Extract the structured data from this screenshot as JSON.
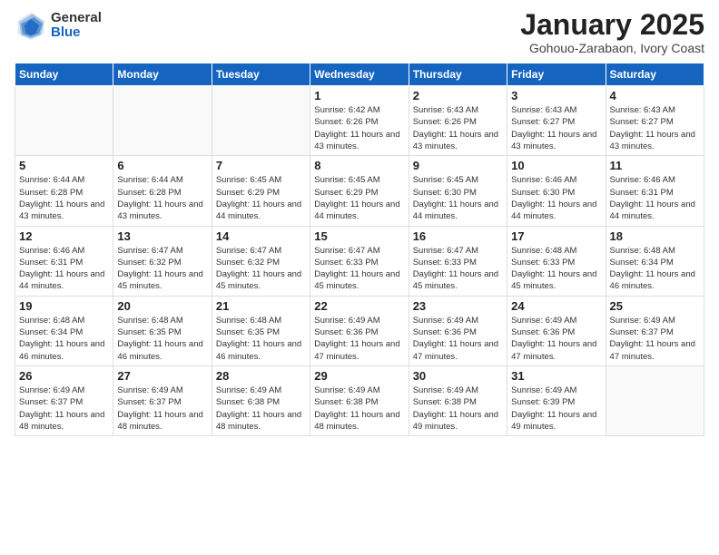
{
  "header": {
    "logo_general": "General",
    "logo_blue": "Blue",
    "month_title": "January 2025",
    "subtitle": "Gohouo-Zarabaon, Ivory Coast"
  },
  "days_of_week": [
    "Sunday",
    "Monday",
    "Tuesday",
    "Wednesday",
    "Thursday",
    "Friday",
    "Saturday"
  ],
  "weeks": [
    [
      {
        "day": "",
        "info": ""
      },
      {
        "day": "",
        "info": ""
      },
      {
        "day": "",
        "info": ""
      },
      {
        "day": "1",
        "info": "Sunrise: 6:42 AM\nSunset: 6:26 PM\nDaylight: 11 hours\nand 43 minutes."
      },
      {
        "day": "2",
        "info": "Sunrise: 6:43 AM\nSunset: 6:26 PM\nDaylight: 11 hours\nand 43 minutes."
      },
      {
        "day": "3",
        "info": "Sunrise: 6:43 AM\nSunset: 6:27 PM\nDaylight: 11 hours\nand 43 minutes."
      },
      {
        "day": "4",
        "info": "Sunrise: 6:43 AM\nSunset: 6:27 PM\nDaylight: 11 hours\nand 43 minutes."
      }
    ],
    [
      {
        "day": "5",
        "info": "Sunrise: 6:44 AM\nSunset: 6:28 PM\nDaylight: 11 hours\nand 43 minutes."
      },
      {
        "day": "6",
        "info": "Sunrise: 6:44 AM\nSunset: 6:28 PM\nDaylight: 11 hours\nand 43 minutes."
      },
      {
        "day": "7",
        "info": "Sunrise: 6:45 AM\nSunset: 6:29 PM\nDaylight: 11 hours\nand 44 minutes."
      },
      {
        "day": "8",
        "info": "Sunrise: 6:45 AM\nSunset: 6:29 PM\nDaylight: 11 hours\nand 44 minutes."
      },
      {
        "day": "9",
        "info": "Sunrise: 6:45 AM\nSunset: 6:30 PM\nDaylight: 11 hours\nand 44 minutes."
      },
      {
        "day": "10",
        "info": "Sunrise: 6:46 AM\nSunset: 6:30 PM\nDaylight: 11 hours\nand 44 minutes."
      },
      {
        "day": "11",
        "info": "Sunrise: 6:46 AM\nSunset: 6:31 PM\nDaylight: 11 hours\nand 44 minutes."
      }
    ],
    [
      {
        "day": "12",
        "info": "Sunrise: 6:46 AM\nSunset: 6:31 PM\nDaylight: 11 hours\nand 44 minutes."
      },
      {
        "day": "13",
        "info": "Sunrise: 6:47 AM\nSunset: 6:32 PM\nDaylight: 11 hours\nand 45 minutes."
      },
      {
        "day": "14",
        "info": "Sunrise: 6:47 AM\nSunset: 6:32 PM\nDaylight: 11 hours\nand 45 minutes."
      },
      {
        "day": "15",
        "info": "Sunrise: 6:47 AM\nSunset: 6:33 PM\nDaylight: 11 hours\nand 45 minutes."
      },
      {
        "day": "16",
        "info": "Sunrise: 6:47 AM\nSunset: 6:33 PM\nDaylight: 11 hours\nand 45 minutes."
      },
      {
        "day": "17",
        "info": "Sunrise: 6:48 AM\nSunset: 6:33 PM\nDaylight: 11 hours\nand 45 minutes."
      },
      {
        "day": "18",
        "info": "Sunrise: 6:48 AM\nSunset: 6:34 PM\nDaylight: 11 hours\nand 46 minutes."
      }
    ],
    [
      {
        "day": "19",
        "info": "Sunrise: 6:48 AM\nSunset: 6:34 PM\nDaylight: 11 hours\nand 46 minutes."
      },
      {
        "day": "20",
        "info": "Sunrise: 6:48 AM\nSunset: 6:35 PM\nDaylight: 11 hours\nand 46 minutes."
      },
      {
        "day": "21",
        "info": "Sunrise: 6:48 AM\nSunset: 6:35 PM\nDaylight: 11 hours\nand 46 minutes."
      },
      {
        "day": "22",
        "info": "Sunrise: 6:49 AM\nSunset: 6:36 PM\nDaylight: 11 hours\nand 47 minutes."
      },
      {
        "day": "23",
        "info": "Sunrise: 6:49 AM\nSunset: 6:36 PM\nDaylight: 11 hours\nand 47 minutes."
      },
      {
        "day": "24",
        "info": "Sunrise: 6:49 AM\nSunset: 6:36 PM\nDaylight: 11 hours\nand 47 minutes."
      },
      {
        "day": "25",
        "info": "Sunrise: 6:49 AM\nSunset: 6:37 PM\nDaylight: 11 hours\nand 47 minutes."
      }
    ],
    [
      {
        "day": "26",
        "info": "Sunrise: 6:49 AM\nSunset: 6:37 PM\nDaylight: 11 hours\nand 48 minutes."
      },
      {
        "day": "27",
        "info": "Sunrise: 6:49 AM\nSunset: 6:37 PM\nDaylight: 11 hours\nand 48 minutes."
      },
      {
        "day": "28",
        "info": "Sunrise: 6:49 AM\nSunset: 6:38 PM\nDaylight: 11 hours\nand 48 minutes."
      },
      {
        "day": "29",
        "info": "Sunrise: 6:49 AM\nSunset: 6:38 PM\nDaylight: 11 hours\nand 48 minutes."
      },
      {
        "day": "30",
        "info": "Sunrise: 6:49 AM\nSunset: 6:38 PM\nDaylight: 11 hours\nand 49 minutes."
      },
      {
        "day": "31",
        "info": "Sunrise: 6:49 AM\nSunset: 6:39 PM\nDaylight: 11 hours\nand 49 minutes."
      },
      {
        "day": "",
        "info": ""
      }
    ]
  ]
}
